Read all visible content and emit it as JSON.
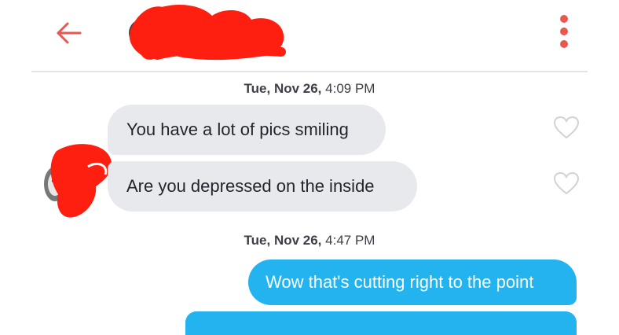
{
  "header": {
    "back_icon": "arrow-left-icon",
    "menu_icon": "more-vertical-icon",
    "accent_color": "#e8584f",
    "scribble_color": "#ff1f10"
  },
  "messages": [
    {
      "timestamp_day": "Tue, Nov 26,",
      "timestamp_time": " 4:09 PM"
    },
    {
      "text": "You have a lot of pics smiling",
      "direction": "incoming"
    },
    {
      "text": "Are you depressed on the inside",
      "direction": "incoming"
    },
    {
      "timestamp_day": "Tue, Nov 26,",
      "timestamp_time": " 4:47 PM"
    },
    {
      "text": "Wow that's cutting right to the point",
      "direction": "outgoing"
    }
  ],
  "colors": {
    "incoming_bubble": "#e8e9ed",
    "outgoing_bubble": "#23b4ef",
    "heart_outline": "#d0d2d6"
  }
}
